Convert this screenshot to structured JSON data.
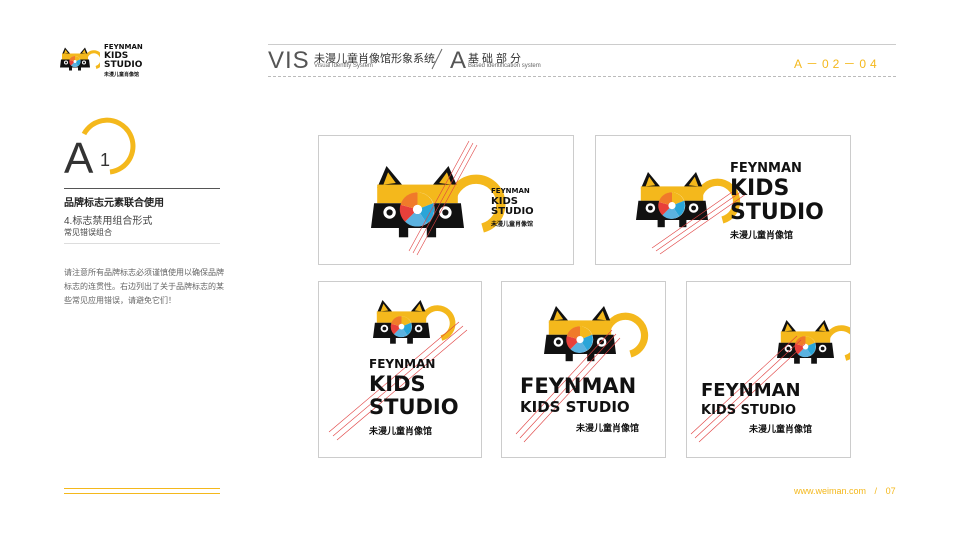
{
  "header": {
    "vis": "VIS",
    "vis_cn": "未漫儿童肖像馆形象系统",
    "vis_en": "Visual Identity System",
    "section_letter": "A",
    "section_cn": "基础部分",
    "section_en": "Based identification system",
    "page_code": "A－02－04"
  },
  "brand": {
    "line1": "FEYNMAN",
    "line2": "KIDS",
    "line3": "STUDIO",
    "line23": "KIDS STUDIO",
    "cn": "未漫儿童肖像馆"
  },
  "left": {
    "section_letter": "A",
    "section_number": "1",
    "title": "品牌标志元素联合使用",
    "subtitle": "4.标志禁用组合形式",
    "subsub": "常见错误组合",
    "description": "请注意所有品牌标志必须谨慎使用以确保品牌标志的连贯性。右边列出了关于品牌标志的某些常见应用错误，请避免它们！"
  },
  "footer": {
    "url": "www.weiman.com",
    "sep": "/",
    "page": "07"
  },
  "colors": {
    "accent": "#f4b81c",
    "cross": "#e04040",
    "ink": "#111111"
  }
}
